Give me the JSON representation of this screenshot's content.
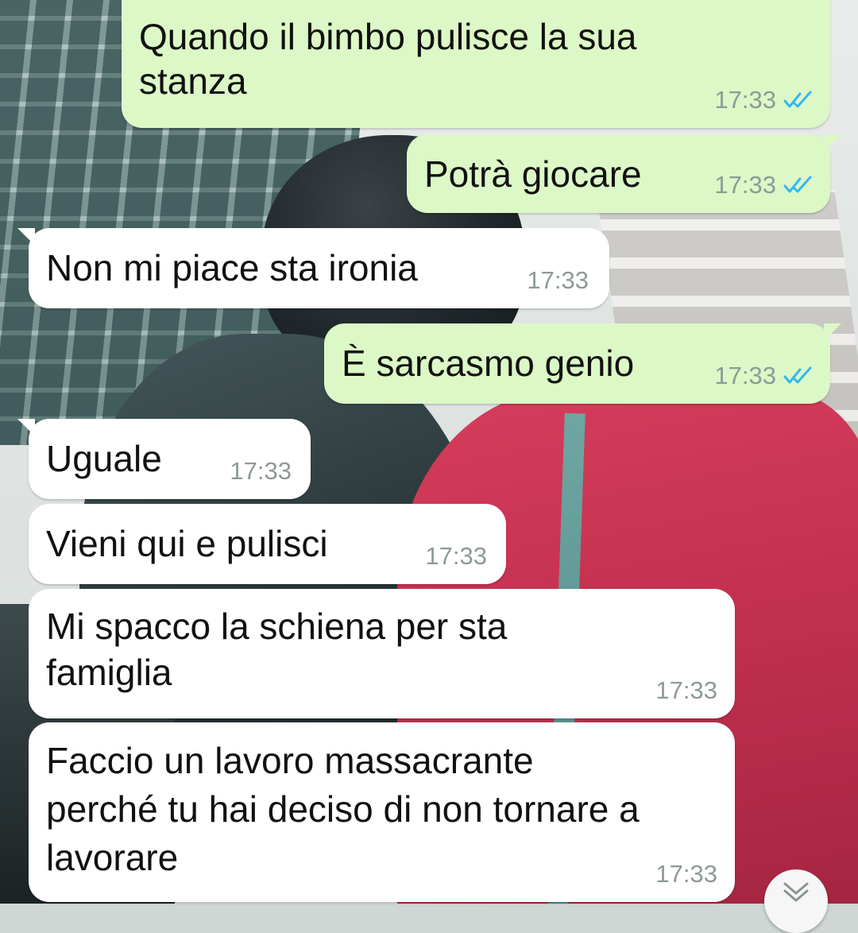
{
  "messages": [
    {
      "direction": "out",
      "text": "Quando il bimbo pulisce la sua\nstanza",
      "time": "17:33",
      "status": "read"
    },
    {
      "direction": "out",
      "text": "Potrà giocare",
      "time": "17:33",
      "status": "read"
    },
    {
      "direction": "in",
      "text": "Non mi piace sta ironia",
      "time": "17:33"
    },
    {
      "direction": "out",
      "text": "È sarcasmo genio",
      "time": "17:33",
      "status": "read"
    },
    {
      "direction": "in",
      "text": "Uguale",
      "time": "17:33"
    },
    {
      "direction": "in",
      "text": "Vieni qui e pulisci",
      "time": "17:33"
    },
    {
      "direction": "in",
      "text": "Mi spacco la schiena per sta\nfamiglia",
      "time": "17:33"
    },
    {
      "direction": "in",
      "text": "Faccio un lavoro massacrante\nperché tu hai deciso di non tornare a\nlavorare",
      "time": "17:33"
    }
  ],
  "colors": {
    "outgoing_bubble": "#dcf8c6",
    "incoming_bubble": "#ffffff",
    "read_ticks": "#34b7f1",
    "timestamp": "#8e9a96"
  },
  "icons": {
    "read_status": "double-check-icon",
    "scroll_down": "double-chevron-down-icon"
  }
}
